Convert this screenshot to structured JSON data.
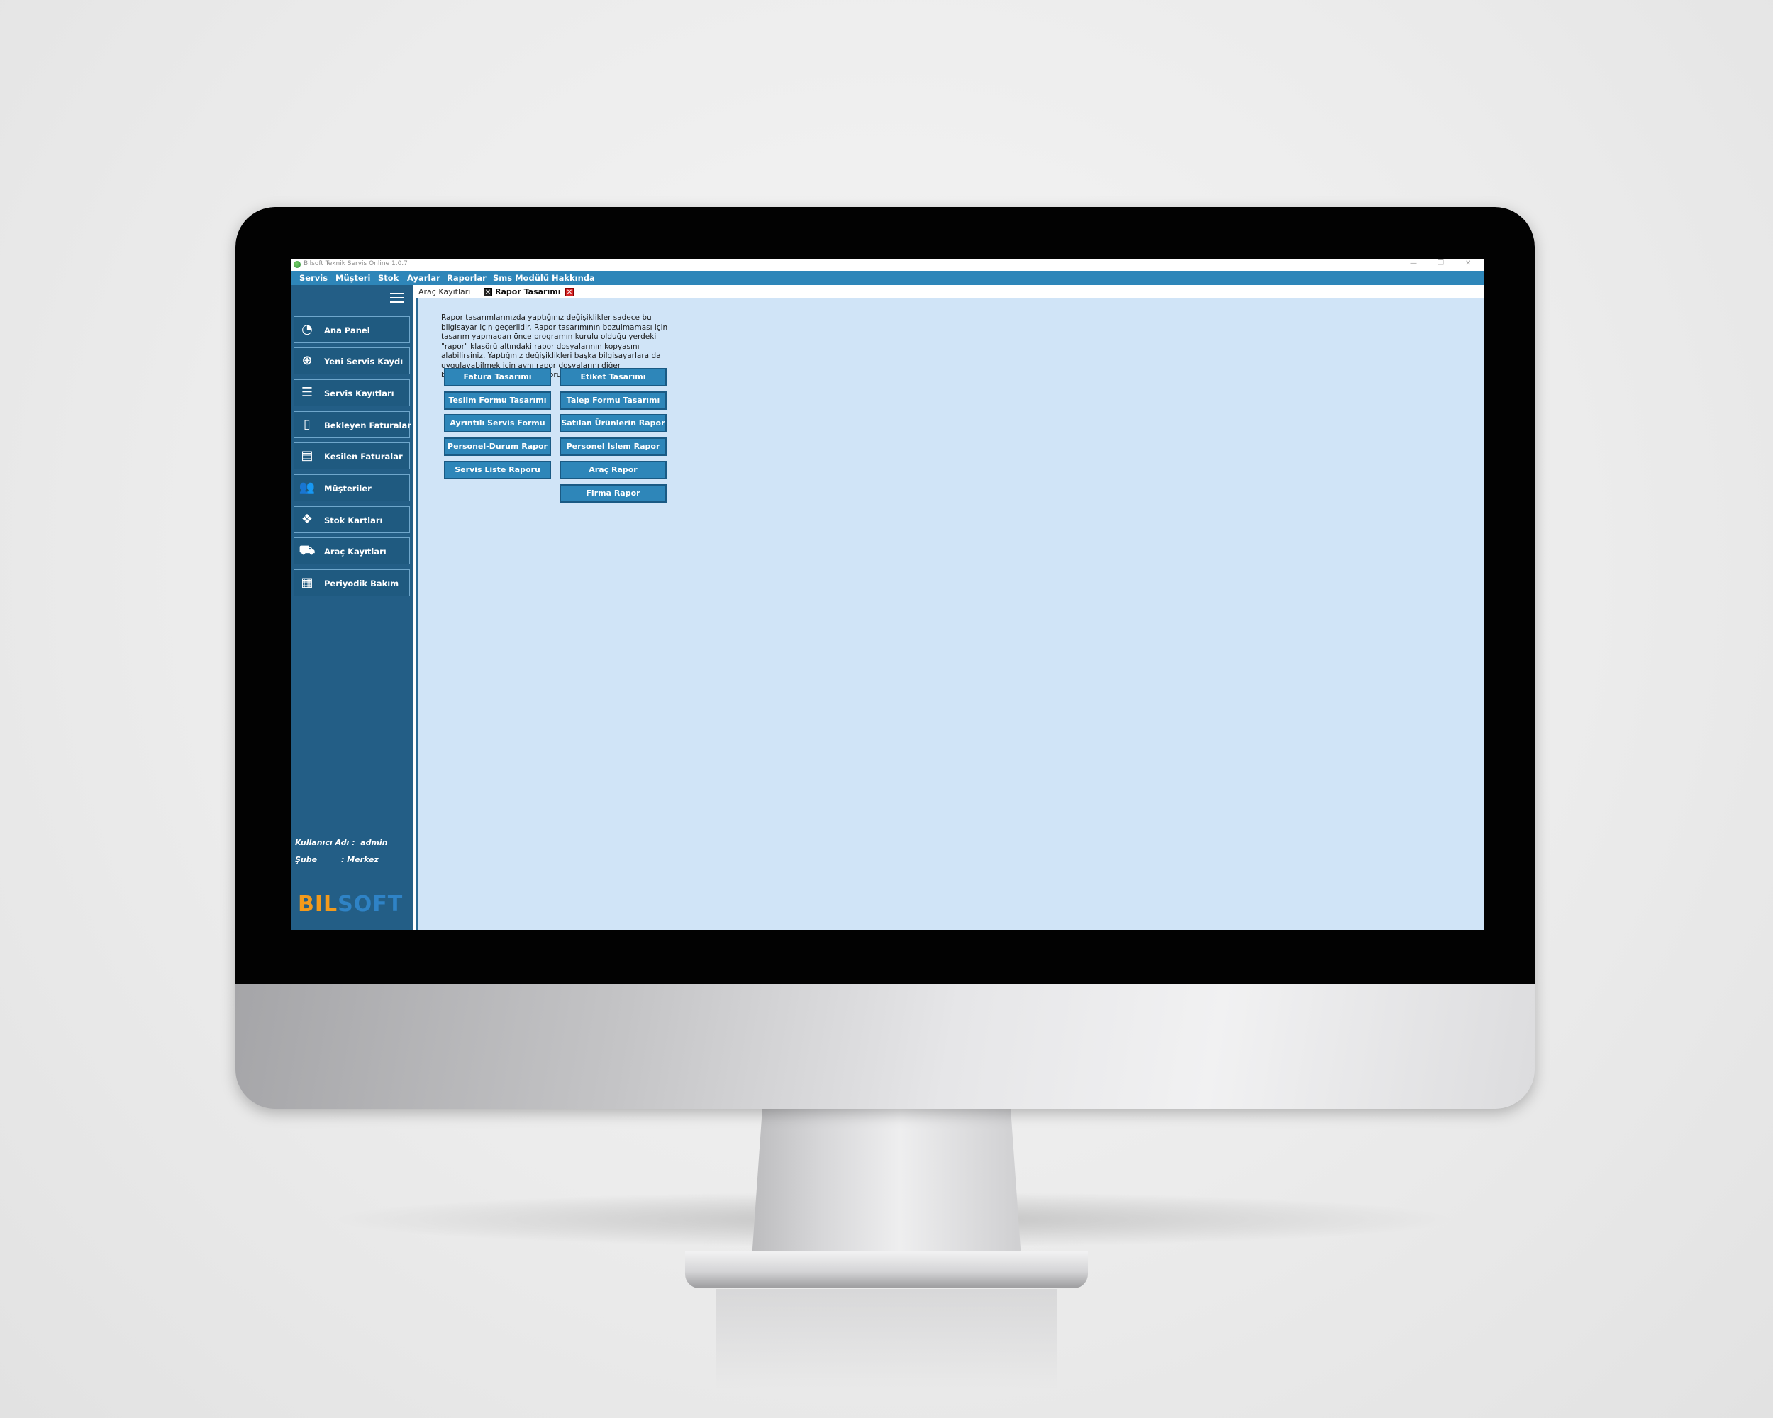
{
  "window": {
    "title": "Bilsoft Teknik Servis Online 1.0.7",
    "minimize": "—",
    "restore": "❐",
    "close": "✕"
  },
  "menu": [
    "Servis",
    "Müşteri",
    "Stok",
    "Ayarlar",
    "Raporlar",
    "Sms Modülü",
    "Hakkında"
  ],
  "sidebar": {
    "items": [
      {
        "label": "Ana Panel",
        "icon": "gauge-icon"
      },
      {
        "label": "Yeni Servis Kaydı",
        "icon": "plus-circle-icon"
      },
      {
        "label": "Servis Kayıtları",
        "icon": "list-icon"
      },
      {
        "label": "Bekleyen Faturalar",
        "icon": "document-icon"
      },
      {
        "label": "Kesilen Faturalar",
        "icon": "receipt-icon"
      },
      {
        "label": "Müşteriler",
        "icon": "users-icon"
      },
      {
        "label": "Stok Kartları",
        "icon": "boxes-icon"
      },
      {
        "label": "Araç Kayıtları",
        "icon": "car-icon"
      },
      {
        "label": "Periyodik Bakım",
        "icon": "calendar-icon"
      }
    ],
    "user_label": "Kullanıcı Adı :",
    "user_value": "admin",
    "branch_label": "Şube",
    "branch_value": ": Merkez",
    "logo_part1": "BIL",
    "logo_part2": "SOFT"
  },
  "tabs": {
    "inactive": "Araç Kayıtları",
    "active": "Rapor Tasarımı"
  },
  "info_text": "Rapor tasarımlarınızda yaptığınız değişiklikler sadece bu bilgisayar için geçerlidir. Rapor tasarımının bozulmaması için tasarım yapmadan önce programın kurulu olduğu yerdeki \"rapor\" klasörü altındaki rapor dosyalarının kopyasını alabilirsiniz. Yaptığınız değişiklikleri başka bilgisayarlara da uygulayabilmek için aynı rapor dosyalarını diğer bilgisayarlardaki \"rapor\" klasörüne",
  "report_buttons": {
    "left": [
      "Fatura Tasarımı",
      "Teslim Formu Tasarımı",
      "Ayrıntılı Servis Formu",
      "Personel-Durum Rapor",
      "Servis Liste Raporu"
    ],
    "right": [
      "Etiket Tasarımı",
      "Talep Formu Tasarımı",
      "Satılan Ürünlerin Rapor",
      "Personel İşlem Rapor",
      "Araç Rapor",
      "Firma Rapor"
    ]
  },
  "colors": {
    "menu_bar": "#2e86b9",
    "sidebar": "#235e86",
    "content_bg": "#d0e4f7",
    "button": "#2e86b9",
    "logo_orange": "#f39a1b",
    "logo_blue": "#2f83c6"
  }
}
